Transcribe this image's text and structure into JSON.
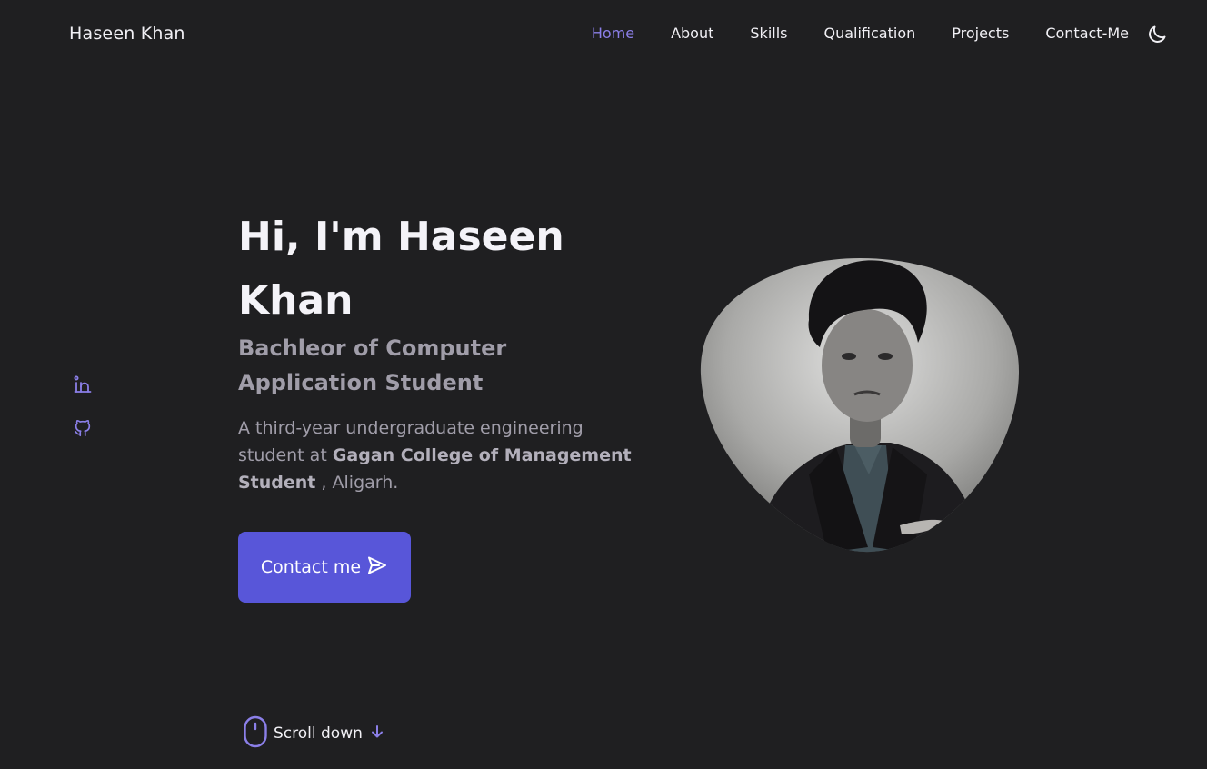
{
  "header": {
    "logo": "Haseen Khan",
    "nav": [
      {
        "label": "Home",
        "active": true
      },
      {
        "label": "About",
        "active": false
      },
      {
        "label": "Skills",
        "active": false
      },
      {
        "label": "Qualification",
        "active": false
      },
      {
        "label": "Projects",
        "active": false
      },
      {
        "label": "Contact-Me",
        "active": false
      }
    ],
    "theme_toggle_icon": "moon-icon"
  },
  "social": [
    {
      "icon": "linkedin-icon"
    },
    {
      "icon": "github-icon"
    }
  ],
  "hero": {
    "title": "Hi, I'm Haseen Khan",
    "subtitle": "Bachleor of Computer Application Student",
    "desc_prefix": "A third-year undergraduate engineering student at ",
    "desc_bold": "Gagan College of Management Student",
    "desc_suffix": " , Aligarh.",
    "button_label": "Contact me",
    "button_icon": "send-icon"
  },
  "scroll": {
    "label": "Scroll down",
    "icon": "mouse-icon",
    "arrow_icon": "arrow-down-icon"
  },
  "colors": {
    "background": "#1f1f21",
    "accent": "#8b7fe8",
    "button": "#5856d9",
    "muted_text": "#a09da9"
  }
}
